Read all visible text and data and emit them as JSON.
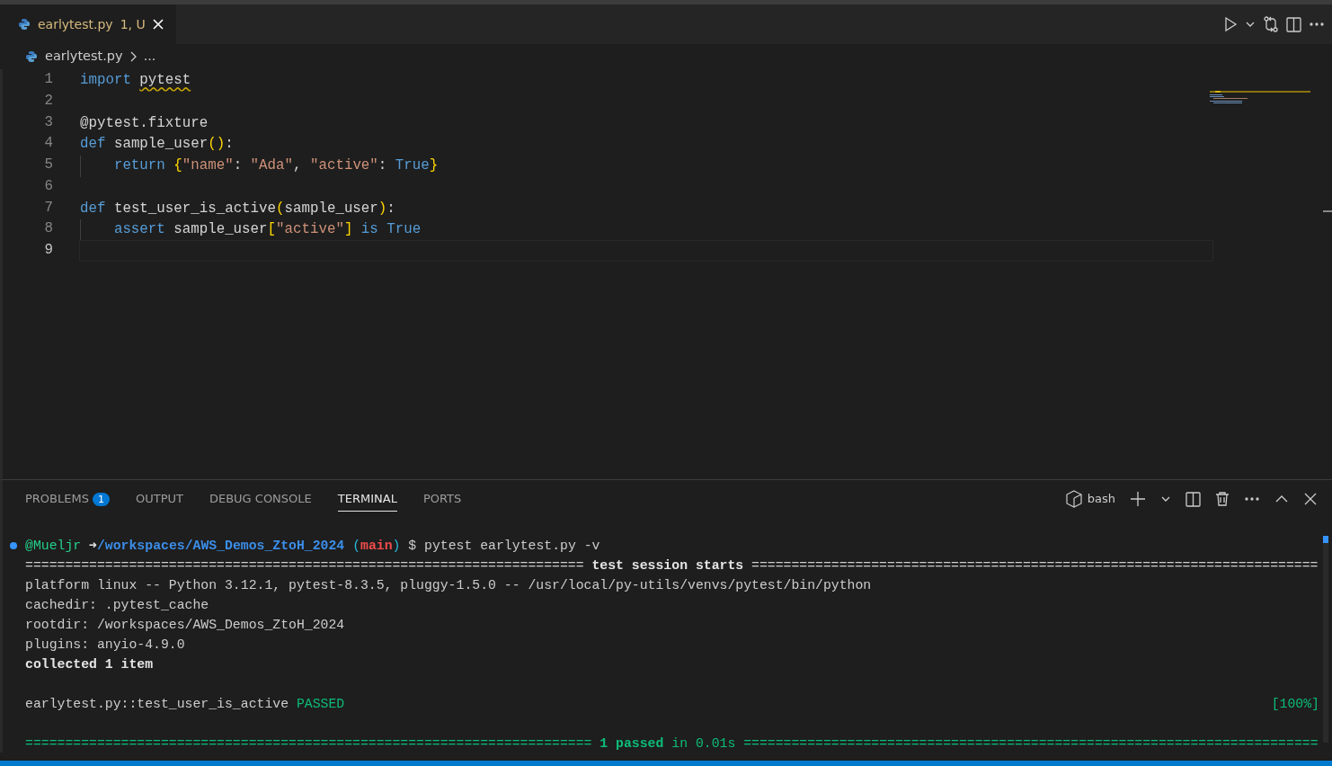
{
  "editor_tabs": [
    {
      "label": "earlytest.py",
      "status": "1, U",
      "selected": true
    }
  ],
  "breadcrumb": {
    "file": "earlytest.py",
    "rest": "..."
  },
  "code_lines": [
    {
      "number": "1",
      "current": false,
      "indented": false,
      "tokens": [
        {
          "kind": "keyword",
          "text": "import "
        },
        {
          "kind": "warning",
          "text": "pytest"
        }
      ]
    },
    {
      "number": "2",
      "current": false,
      "indented": false
    },
    {
      "number": "3",
      "current": false,
      "indented": false,
      "tokens": [
        {
          "kind": "plain",
          "text": "@pytest.fixture"
        }
      ]
    },
    {
      "number": "4",
      "current": false,
      "indented": false,
      "tokens": [
        {
          "kind": "keyword",
          "text": "def "
        },
        {
          "kind": "plain",
          "text": "sample_user"
        },
        {
          "kind": "bracket",
          "text": "()"
        },
        {
          "kind": "plain",
          "text": ":"
        }
      ]
    },
    {
      "number": "5",
      "current": false,
      "indented": true,
      "tokens": [
        {
          "kind": "keyword",
          "text": "return "
        },
        {
          "kind": "bracket",
          "text": "{"
        },
        {
          "kind": "string",
          "text": "\"name\""
        },
        {
          "kind": "plain",
          "text": ": "
        },
        {
          "kind": "string",
          "text": "\"Ada\""
        },
        {
          "kind": "plain",
          "text": ", "
        },
        {
          "kind": "string",
          "text": "\"active\""
        },
        {
          "kind": "plain",
          "text": ": "
        },
        {
          "kind": "keyword",
          "text": "True"
        },
        {
          "kind": "bracket",
          "text": "}"
        }
      ]
    },
    {
      "number": "6",
      "current": false,
      "indented": false
    },
    {
      "number": "7",
      "current": false,
      "indented": false,
      "tokens": [
        {
          "kind": "keyword",
          "text": "def "
        },
        {
          "kind": "plain",
          "text": "test_user_is_active"
        },
        {
          "kind": "bracket",
          "text": "("
        },
        {
          "kind": "plain",
          "text": "sample_user"
        },
        {
          "kind": "bracket",
          "text": ")"
        },
        {
          "kind": "plain",
          "text": ":"
        }
      ]
    },
    {
      "number": "8",
      "current": false,
      "indented": true,
      "tokens": [
        {
          "kind": "keyword",
          "text": "assert "
        },
        {
          "kind": "plain",
          "text": "sample_user"
        },
        {
          "kind": "bracket",
          "text": "["
        },
        {
          "kind": "string",
          "text": "\"active\""
        },
        {
          "kind": "bracket",
          "text": "]"
        },
        {
          "kind": "keyword",
          "text": " is True"
        }
      ]
    },
    {
      "number": "9",
      "current": true,
      "indented": false
    }
  ],
  "panel_tabs": [
    {
      "label": "PROBLEMS",
      "badge": "1",
      "selected": false
    },
    {
      "label": "OUTPUT",
      "selected": false
    },
    {
      "label": "DEBUG CONSOLE",
      "selected": false
    },
    {
      "label": "TERMINAL",
      "selected": true
    },
    {
      "label": "PORTS",
      "selected": false
    }
  ],
  "terminal": {
    "shell": "bash",
    "lines": [
      {
        "prompt": true,
        "segments": [
          {
            "kind": "user",
            "text": "@Mueljr "
          },
          {
            "kind": "arrow",
            "text": "➜"
          },
          {
            "kind": "path",
            "text": "/workspaces/AWS_Demos_ZtoH_2024"
          },
          {
            "kind": "paren",
            "text": " ("
          },
          {
            "kind": "branch",
            "text": "main"
          },
          {
            "kind": "paren",
            "text": ")"
          },
          {
            "kind": "plain",
            "text": " $ pytest earlytest.py -v"
          }
        ]
      },
      {
        "prompt": false,
        "segments": [
          {
            "kind": "plain",
            "text": "====================================================================== "
          },
          {
            "kind": "bold",
            "text": "test session starts"
          },
          {
            "kind": "plain",
            "text": " ======================================================================="
          }
        ]
      },
      {
        "prompt": false,
        "segments": [
          {
            "kind": "plain",
            "text": "platform linux -- Python 3.12.1, pytest-8.3.5, pluggy-1.5.0 -- /usr/local/py-utils/venvs/pytest/bin/python"
          }
        ]
      },
      {
        "prompt": false,
        "segments": [
          {
            "kind": "plain",
            "text": "cachedir: .pytest_cache"
          }
        ]
      },
      {
        "prompt": false,
        "segments": [
          {
            "kind": "plain",
            "text": "rootdir: /workspaces/AWS_Demos_ZtoH_2024"
          }
        ]
      },
      {
        "prompt": false,
        "segments": [
          {
            "kind": "plain",
            "text": "plugins: anyio-4.9.0"
          }
        ]
      },
      {
        "prompt": false,
        "segments": [
          {
            "kind": "bold",
            "text": "collected 1 item"
          }
        ]
      },
      {
        "prompt": false
      },
      {
        "prompt": false,
        "segments": [
          {
            "kind": "plain",
            "text": "earlytest.py::test_user_is_active "
          },
          {
            "kind": "passed",
            "text": "PASSED"
          }
        ],
        "right": "[100%]"
      },
      {
        "prompt": false
      },
      {
        "prompt": false,
        "segments": [
          {
            "kind": "passed",
            "text": "======================================================================= "
          },
          {
            "kind": "passedbold",
            "text": "1 passed"
          },
          {
            "kind": "passed",
            "text": " in 0.01s ========================================================================"
          }
        ]
      }
    ]
  }
}
